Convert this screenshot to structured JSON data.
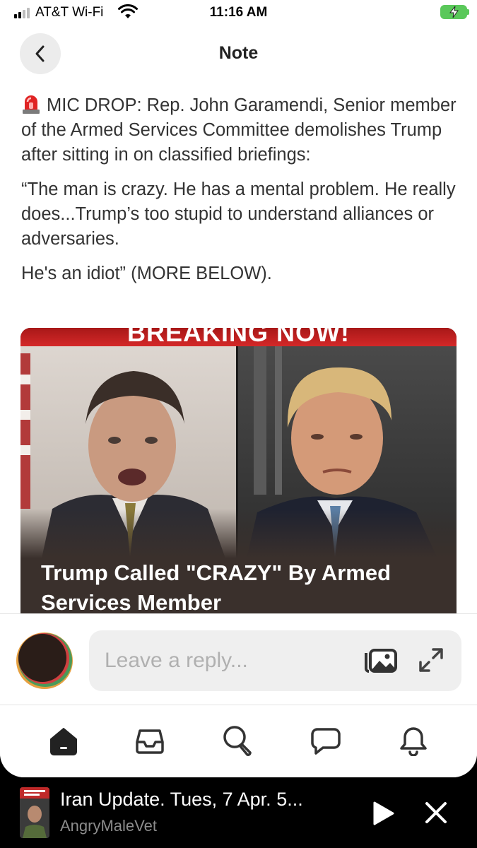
{
  "status_bar": {
    "carrier": "AT&T Wi-Fi",
    "time": "11:16 AM",
    "battery_charging": true
  },
  "header": {
    "title": "Note",
    "back_icon": "chevron-left-icon"
  },
  "note": {
    "paragraphs": [
      "MIC DROP: Rep. John Garamendi, Senior member of the Armed Services Committee demolishes Trump after sitting in on classified briefings:",
      "“The man is crazy. He has a mental problem. He really does...Trump’s too stupid to understand alliances or adversaries.",
      "He's an idiot” (MORE BELOW)."
    ],
    "lead_icon": "siren-icon"
  },
  "card": {
    "banner": "BREAKING NOW!",
    "caption": "Trump Called \"CRAZY\" By Armed Services Member"
  },
  "reply": {
    "placeholder": "Leave a reply...",
    "media_icon": "photo-gallery-icon",
    "expand_icon": "expand-icon"
  },
  "tabs": [
    {
      "name": "home",
      "icon": "home-icon",
      "active": true
    },
    {
      "name": "inbox",
      "icon": "inbox-icon",
      "active": false
    },
    {
      "name": "search",
      "icon": "search-icon",
      "active": false
    },
    {
      "name": "chat",
      "icon": "chat-icon",
      "active": false
    },
    {
      "name": "activity",
      "icon": "bell-icon",
      "active": false
    }
  ],
  "player": {
    "title": "Iran Update. Tues, 7 Apr. 5...",
    "author": "AngryMaleVet",
    "play_icon": "play-icon",
    "close_icon": "close-icon"
  },
  "colors": {
    "battery": "#5ac85a",
    "card_background": "#3a302c",
    "banner_red": "#c82020"
  }
}
